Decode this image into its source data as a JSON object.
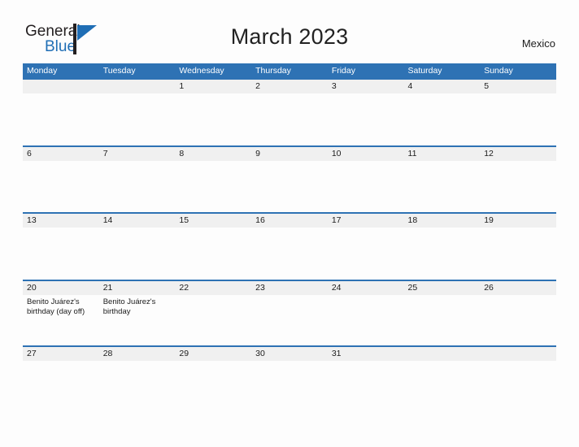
{
  "logo": {
    "word_one": "General",
    "word_two": "Blue",
    "mark": "blue-flag-triangle"
  },
  "header": {
    "title": "March 2023",
    "country": "Mexico"
  },
  "colors": {
    "header_blue": "#2e72b4",
    "rule_blue": "#2e72b4",
    "date_band_gray": "#f0f0f0",
    "logo_blue": "#1f6eb5",
    "text": "#1c1c1c",
    "page_background": "#fdfdfd"
  },
  "calendar": {
    "weekdays": [
      "Monday",
      "Tuesday",
      "Wednesday",
      "Thursday",
      "Friday",
      "Saturday",
      "Sunday"
    ],
    "weeks": [
      {
        "days": [
          {
            "date": "",
            "event": ""
          },
          {
            "date": "",
            "event": ""
          },
          {
            "date": "1",
            "event": ""
          },
          {
            "date": "2",
            "event": ""
          },
          {
            "date": "3",
            "event": ""
          },
          {
            "date": "4",
            "event": ""
          },
          {
            "date": "5",
            "event": ""
          }
        ]
      },
      {
        "days": [
          {
            "date": "6",
            "event": ""
          },
          {
            "date": "7",
            "event": ""
          },
          {
            "date": "8",
            "event": ""
          },
          {
            "date": "9",
            "event": ""
          },
          {
            "date": "10",
            "event": ""
          },
          {
            "date": "11",
            "event": ""
          },
          {
            "date": "12",
            "event": ""
          }
        ]
      },
      {
        "days": [
          {
            "date": "13",
            "event": ""
          },
          {
            "date": "14",
            "event": ""
          },
          {
            "date": "15",
            "event": ""
          },
          {
            "date": "16",
            "event": ""
          },
          {
            "date": "17",
            "event": ""
          },
          {
            "date": "18",
            "event": ""
          },
          {
            "date": "19",
            "event": ""
          }
        ]
      },
      {
        "days": [
          {
            "date": "20",
            "event": "Benito Juárez's birthday (day off)"
          },
          {
            "date": "21",
            "event": "Benito Juárez's birthday"
          },
          {
            "date": "22",
            "event": ""
          },
          {
            "date": "23",
            "event": ""
          },
          {
            "date": "24",
            "event": ""
          },
          {
            "date": "25",
            "event": ""
          },
          {
            "date": "26",
            "event": ""
          }
        ]
      },
      {
        "days": [
          {
            "date": "27",
            "event": ""
          },
          {
            "date": "28",
            "event": ""
          },
          {
            "date": "29",
            "event": ""
          },
          {
            "date": "30",
            "event": ""
          },
          {
            "date": "31",
            "event": ""
          },
          {
            "date": "",
            "event": ""
          },
          {
            "date": "",
            "event": ""
          }
        ]
      }
    ]
  }
}
